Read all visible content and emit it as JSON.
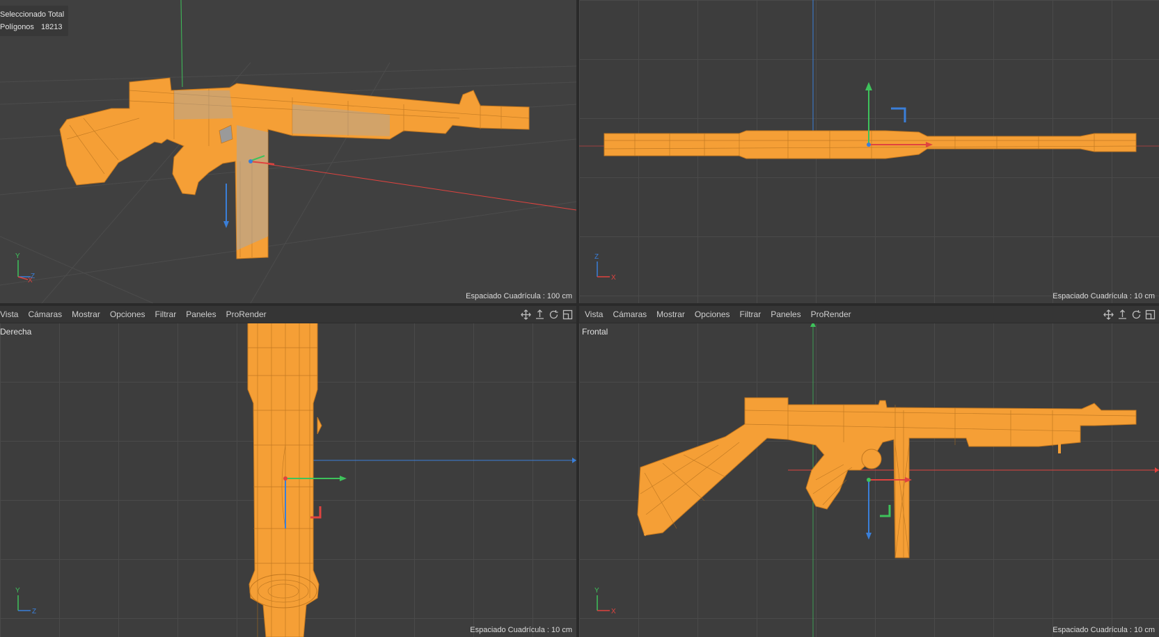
{
  "viewports": {
    "perspective": {
      "info": {
        "header": "Seleccionado Total",
        "stat_label": "Polígonos",
        "stat_value": "18213"
      },
      "grid_spacing": "Espaciado Cuadrícula : 100 cm",
      "axis": {
        "up": "Y",
        "a": "Z",
        "b": "X"
      }
    },
    "top": {
      "grid_spacing": "Espaciado Cuadrícula : 10 cm",
      "axis": {
        "up": "Z",
        "side": "X"
      }
    },
    "right": {
      "menu": [
        "Vista",
        "Cámaras",
        "Mostrar",
        "Opciones",
        "Filtrar",
        "Paneles",
        "ProRender"
      ],
      "label": "Derecha",
      "grid_spacing": "Espaciado Cuadrícula : 10 cm",
      "axis": {
        "up": "Y",
        "side": "Z"
      }
    },
    "front": {
      "menu": [
        "Vista",
        "Cámaras",
        "Mostrar",
        "Opciones",
        "Filtrar",
        "Paneles",
        "ProRender"
      ],
      "label": "Frontal",
      "grid_spacing": "Espaciado Cuadrícula : 10 cm",
      "axis": {
        "up": "Y",
        "side": "X"
      }
    }
  },
  "nav_icons": [
    "move-view-icon",
    "dolly-view-icon",
    "rotate-view-icon",
    "maximize-view-icon"
  ],
  "colors": {
    "background": "#3d3d3d",
    "grid": "#4a4a4a",
    "model": "#f59f36",
    "model_dark": "#c4781f",
    "x_axis": "#e0433f",
    "y_axis": "#3ec25b",
    "z_axis": "#3a7fd9"
  }
}
